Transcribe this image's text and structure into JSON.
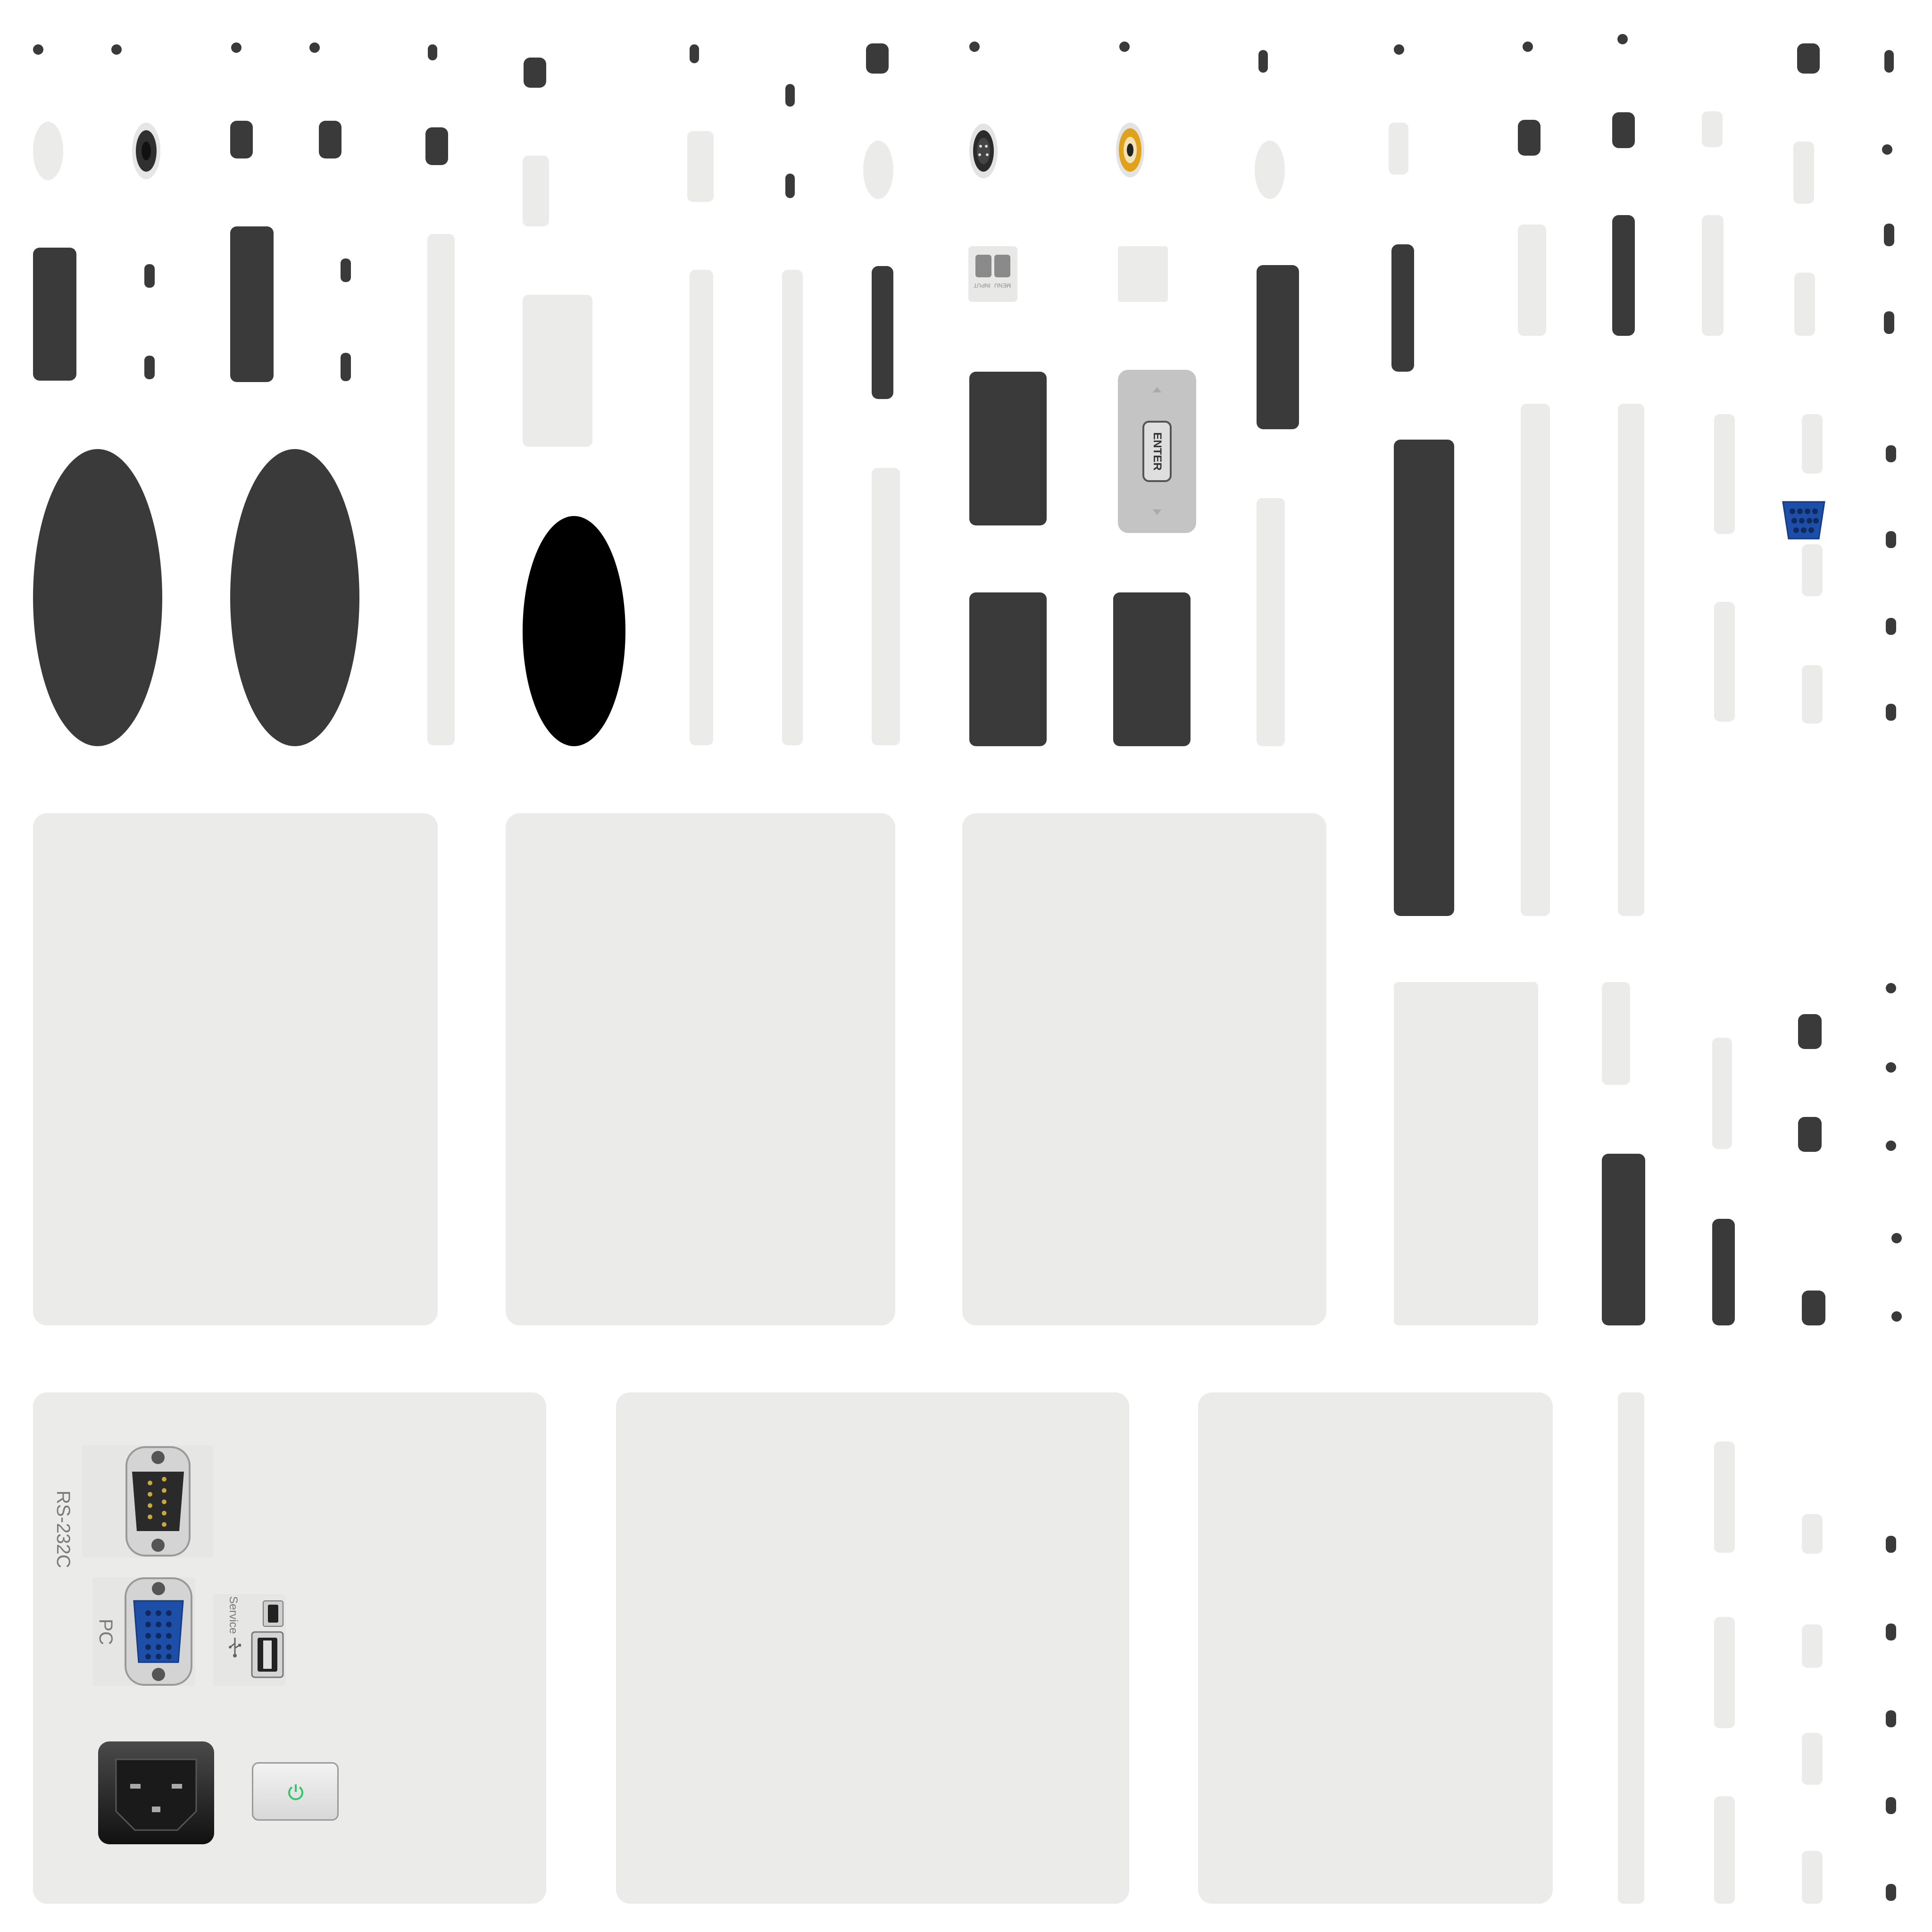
{
  "port_labels": {
    "rs232c": "RS-232C",
    "pc": "PC",
    "service": "Service",
    "enter": "ENTER",
    "input": "INPUT",
    "menu": "MENU"
  },
  "colors": {
    "dark": "#3a3a3a",
    "light": "#ebebea",
    "vga_blue": "#1e4fa8",
    "rca_yellow": "#e0a21a",
    "power_led_green": "#34c46a"
  },
  "icons": [
    "vga-port-icon",
    "serial-port-icon",
    "usb-port-icon",
    "power-inlet-icon",
    "power-button-icon",
    "rca-jack-icon",
    "svideo-jack-icon",
    "enter-button-icon"
  ]
}
